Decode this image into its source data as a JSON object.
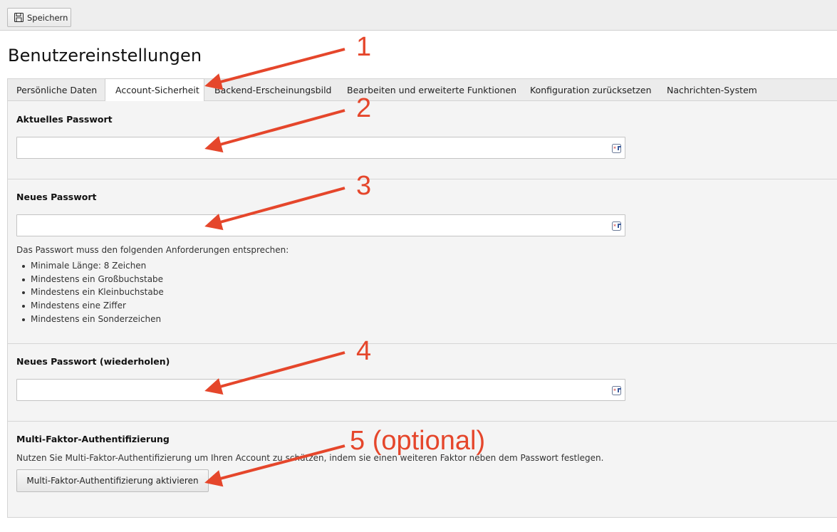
{
  "toolbar": {
    "save_label": "Speichern",
    "save_icon": "floppy-disk-icon"
  },
  "page": {
    "title": "Benutzereinstellungen"
  },
  "tabs": [
    {
      "label": "Persönliche Daten",
      "active": false
    },
    {
      "label": "Account-Sicherheit",
      "active": true
    },
    {
      "label": "Backend-Erscheinungsbild",
      "active": false
    },
    {
      "label": "Bearbeiten und erweiterte Funktionen",
      "active": false
    },
    {
      "label": "Konfiguration zurücksetzen",
      "active": false
    },
    {
      "label": "Nachrichten-System",
      "active": false
    }
  ],
  "current_password": {
    "label": "Aktuelles Passwort",
    "value": "",
    "placeholder": "",
    "icon": "password-manager-key-icon"
  },
  "new_password": {
    "label": "Neues Passwort",
    "value": "",
    "placeholder": "",
    "icon": "password-manager-key-icon",
    "requirements_intro": "Das Passwort muss den folgenden Anforderungen entsprechen:",
    "requirements": [
      "Minimale Länge: 8 Zeichen",
      "Mindestens ein Großbuchstabe",
      "Mindestens ein Kleinbuchstabe",
      "Mindestens eine Ziffer",
      "Mindestens ein Sonderzeichen"
    ]
  },
  "repeat_password": {
    "label": "Neues Passwort (wiederholen)",
    "value": "",
    "placeholder": "",
    "icon": "password-manager-key-icon"
  },
  "mfa": {
    "title": "Multi-Faktor-Authentifizierung",
    "description": "Nutzen Sie Multi-Faktor-Authentifizierung um Ihren Account zu schützen, indem sie einen weiteren Faktor neben dem Passwort festlegen.",
    "button_label": "Multi-Faktor-Authentifizierung aktivieren"
  },
  "annotations": {
    "color": "#e5462b",
    "labels": [
      "1",
      "2",
      "3",
      "4",
      "5 (optional)"
    ]
  }
}
